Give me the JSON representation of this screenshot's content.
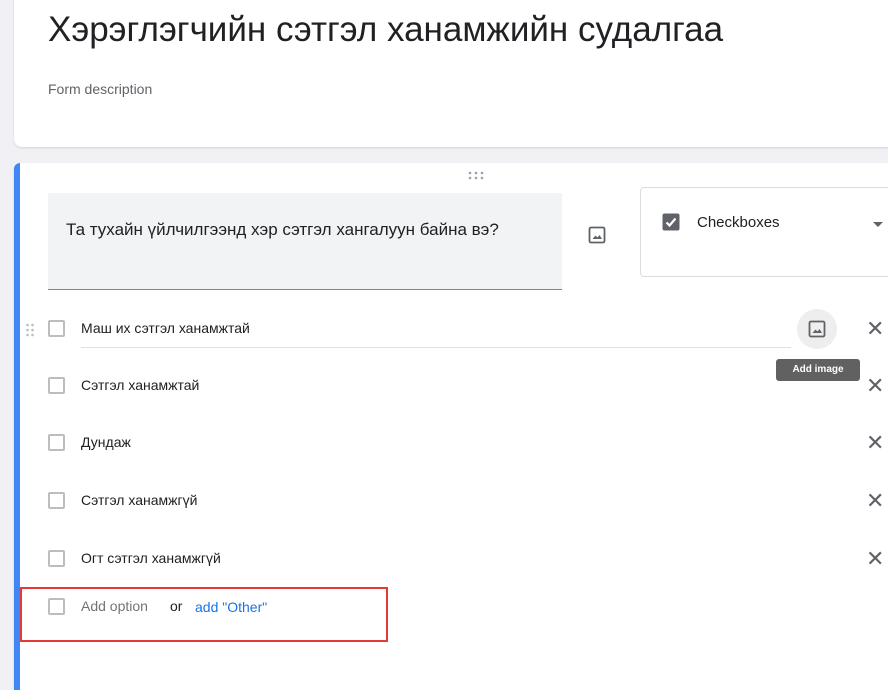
{
  "form": {
    "title": "Хэрэглэгчийн сэтгэл ханамжийн судалгаа",
    "description": "Form description"
  },
  "question": {
    "text": "Та тухайн үйлчилгээнд хэр сэтгэл хангалуун байна вэ?",
    "type_label": "Checkboxes",
    "accent_color": "#4285f4"
  },
  "options": [
    {
      "label": "Маш их сэтгэл ханамжтай"
    },
    {
      "label": "Сэтгэл ханамжтай"
    },
    {
      "label": "Дундаж"
    },
    {
      "label": "Сэтгэл ханамжгүй"
    },
    {
      "label": "Огт сэтгэл ханамжгүй"
    }
  ],
  "tooltip": {
    "text": "Add image"
  },
  "add_option": {
    "label": "Add option",
    "or_text": "or",
    "other_link": "add \"Other\""
  },
  "icons": {
    "drag": "drag-handle-icon",
    "image": "image-icon",
    "checkbox": "checkbox-checked-icon",
    "caret": "dropdown-arrow-icon",
    "remove": "close-icon"
  },
  "highlight_color": "#e53935"
}
